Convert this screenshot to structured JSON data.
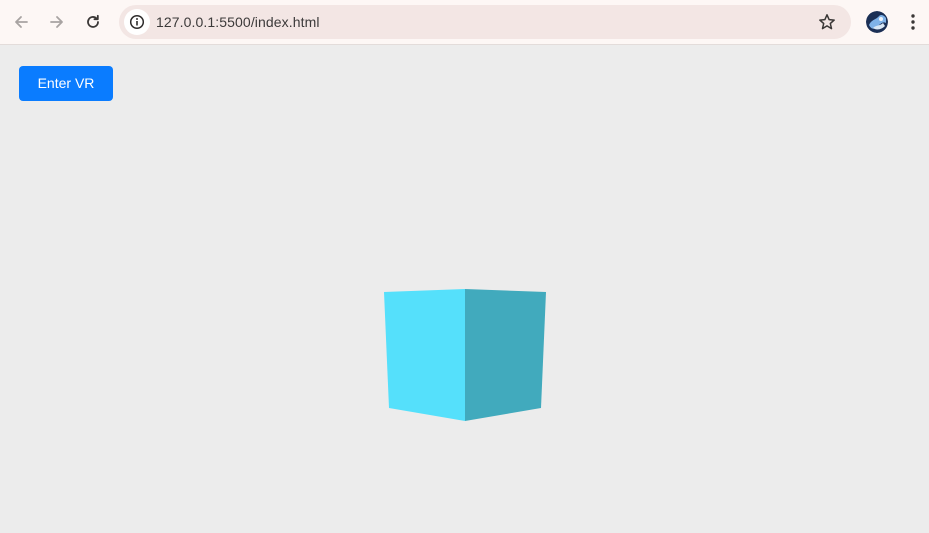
{
  "browser": {
    "url": "127.0.0.1:5500/index.html",
    "icons": {
      "back": "arrow-left-icon",
      "forward": "arrow-right-icon",
      "reload": "reload-icon",
      "site_info": "info-icon",
      "bookmark": "star-icon",
      "profile": "avatar",
      "menu": "kebab-menu-icon"
    }
  },
  "page": {
    "vr_button_label": "Enter VR",
    "background_color": "#ececec",
    "button_color": "#0a7cff"
  },
  "scene": {
    "object": "cube",
    "front_face_color": "#55e0fb",
    "side_face_color": "#41aabd"
  }
}
